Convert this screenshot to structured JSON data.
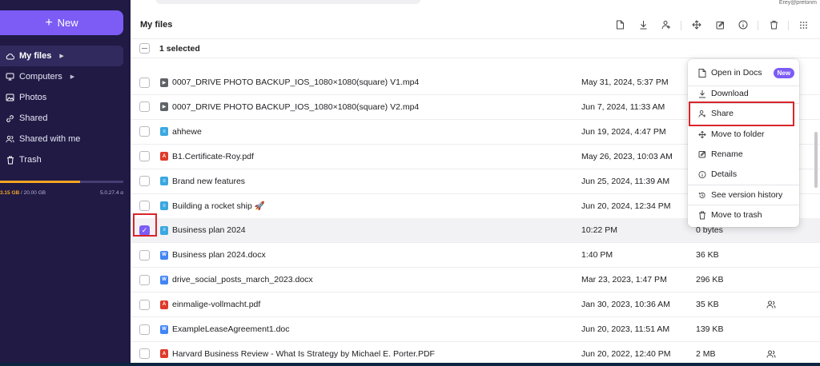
{
  "sidebar": {
    "new_label": "New",
    "items": [
      {
        "label": "My files",
        "icon": "cloud-icon",
        "active": true,
        "arrow": true
      },
      {
        "label": "Computers",
        "icon": "monitor-icon",
        "active": false,
        "arrow": true
      },
      {
        "label": "Photos",
        "icon": "image-icon",
        "active": false,
        "arrow": false
      },
      {
        "label": "Shared",
        "icon": "link-icon",
        "active": false,
        "arrow": false
      },
      {
        "label": "Shared with me",
        "icon": "users-icon",
        "active": false,
        "arrow": false
      },
      {
        "label": "Trash",
        "icon": "trash-icon",
        "active": false,
        "arrow": false
      }
    ],
    "storage": {
      "used": "3.15 GB",
      "total": " / 20.00 GB",
      "version": "5.0.27.4 α",
      "fraction": 0.65
    }
  },
  "top": {
    "email_fragment": "Erey@pretonm"
  },
  "header": {
    "title": "My files"
  },
  "selection": {
    "text": "1 selected"
  },
  "files": [
    {
      "name": "0007_DRIVE PHOTO BACKUP_IOS_1080×1080(square) V1.mp4",
      "type": "video",
      "date": "May 31, 2024, 5:37 PM",
      "size": "",
      "shared": false,
      "selected": false
    },
    {
      "name": "0007_DRIVE PHOTO BACKUP_IOS_1080×1080(square) V2.mp4",
      "type": "video",
      "date": "Jun 7, 2024, 11:33 AM",
      "size": "",
      "shared": false,
      "selected": false
    },
    {
      "name": "ahhewe",
      "type": "doc",
      "date": "Jun 19, 2024, 4:47 PM",
      "size": "",
      "shared": false,
      "selected": false
    },
    {
      "name": "B1.Certificate-Roy.pdf",
      "type": "pdf",
      "date": "May 26, 2023, 10:03 AM",
      "size": "",
      "shared": false,
      "selected": false
    },
    {
      "name": "Brand new features",
      "type": "doc",
      "date": "Jun 25, 2024, 11:39 AM",
      "size": "",
      "shared": false,
      "selected": false
    },
    {
      "name": "Building a rocket ship 🚀",
      "type": "doc",
      "date": "Jun 20, 2024, 12:34 PM",
      "size": "",
      "shared": false,
      "selected": false
    },
    {
      "name": "Business plan 2024",
      "type": "doc",
      "date": "10:22 PM",
      "size": "0 bytes",
      "shared": false,
      "selected": true
    },
    {
      "name": "Business plan 2024.docx",
      "type": "word",
      "date": "1:40 PM",
      "size": "36 KB",
      "shared": false,
      "selected": false
    },
    {
      "name": "drive_social_posts_march_2023.docx",
      "type": "word",
      "date": "Mar 23, 2023, 1:47 PM",
      "size": "296 KB",
      "shared": false,
      "selected": false
    },
    {
      "name": "einmalige-vollmacht.pdf",
      "type": "pdf",
      "date": "Jan 30, 2023, 10:36 AM",
      "size": "35 KB",
      "shared": true,
      "selected": false
    },
    {
      "name": "ExampleLeaseAgreement1.doc",
      "type": "word",
      "date": "Jun 20, 2023, 11:51 AM",
      "size": "139 KB",
      "shared": false,
      "selected": false
    },
    {
      "name": "Harvard Business Review - What Is Strategy by Michael E. Porter.PDF",
      "type": "pdf",
      "date": "Jun 20, 2022, 12:40 PM",
      "size": "2 MB",
      "shared": true,
      "selected": false
    }
  ],
  "context_menu": {
    "open_in_docs": "Open in Docs",
    "new_badge": "New",
    "download": "Download",
    "share": "Share",
    "move_to_folder": "Move to folder",
    "rename": "Rename",
    "details": "Details",
    "version_history": "See version history",
    "move_to_trash": "Move to trash"
  },
  "colors": {
    "accent": "#7c5cf5",
    "sidebar": "#201a45",
    "highlight": "#d9252b",
    "storage": "#f5a524"
  }
}
